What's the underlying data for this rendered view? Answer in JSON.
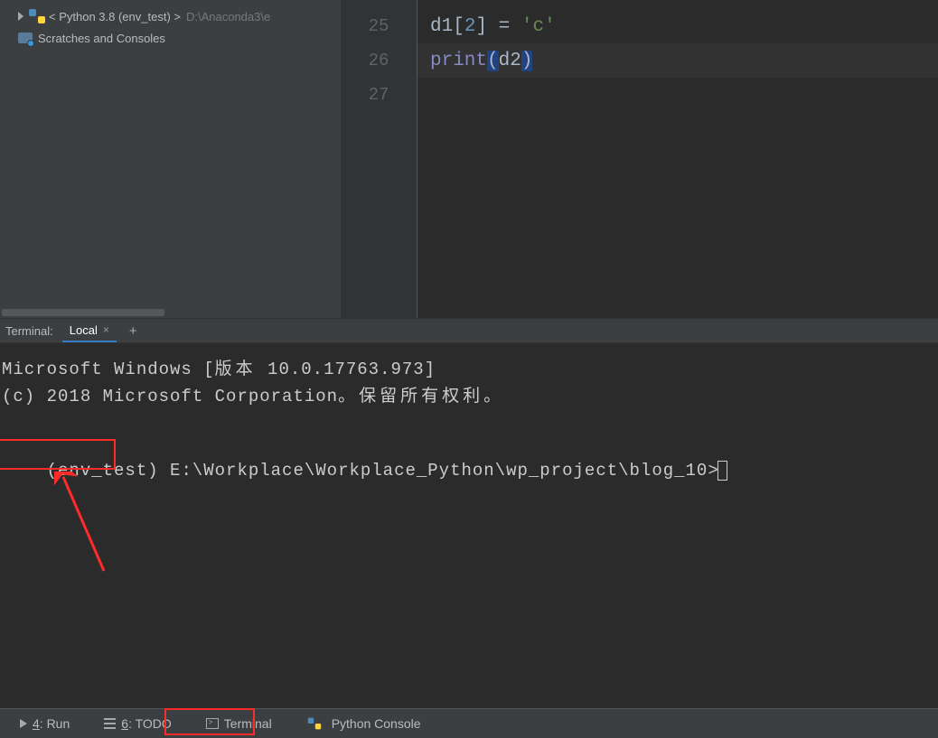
{
  "project": {
    "libs_prefix": "< Python 3.8 (env_test) >",
    "libs_path": "D:\\Anaconda3\\e",
    "scratches_label": "Scratches and Consoles"
  },
  "editor": {
    "line_numbers": [
      "25",
      "26",
      "27"
    ],
    "line25": {
      "id": "d1",
      "br_open": "[",
      "idx": "2",
      "br_close": "]",
      "sp_eq": " = ",
      "str": "'c'"
    },
    "line26": {
      "fn": "print",
      "lp": "(",
      "arg": "d2",
      "rp": ")"
    }
  },
  "terminal": {
    "header_label": "Terminal:",
    "tab_label": "Local",
    "plus": "+",
    "close": "×",
    "line1_a": "Microsoft Windows [",
    "line1_b": "版本",
    "line1_c": " 10.0.17763.973]",
    "line2_a": "(c) 2018 Microsoft Corporation",
    "line2_b": "。保留所有权利。",
    "env_prefix": "(env_test)",
    "prompt_path": " E:\\Workplace\\Workplace_Python\\wp_project\\blog_10>"
  },
  "bottom": {
    "run_u": "4",
    "run_rest": ": Run",
    "todo_u": "6",
    "todo_rest": ": TODO",
    "terminal": "Terminal",
    "python_console": "Python Console"
  }
}
